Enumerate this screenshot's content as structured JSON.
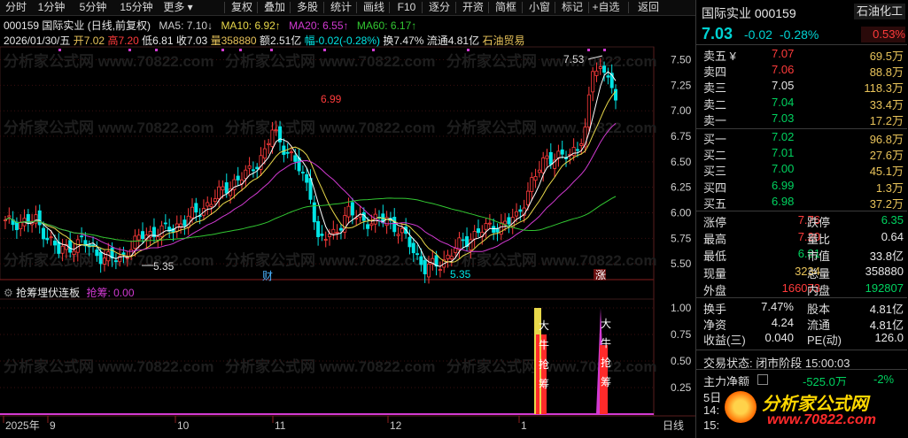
{
  "toolbar": {
    "left_items": [
      "分时",
      "1分钟",
      "5分钟",
      "15分钟",
      "更多 ▾"
    ],
    "right_items": [
      "复权",
      "叠加",
      "多股",
      "统计",
      "画线",
      "F10",
      "逐分",
      "开资",
      "简框",
      "小窗",
      "标记",
      "+自选",
      "返回"
    ]
  },
  "info_line1": {
    "code_name": "000159 国际实业 (日线,前复权)",
    "ma5": "MA5: 7.10↓",
    "ma10": "MA10: 6.92↑",
    "ma20": "MA20: 6.55↑",
    "ma60": "MA60: 6.17↑"
  },
  "info_line2": {
    "date": "2026/01/30/五",
    "open": "开7.02",
    "high": "高7.20",
    "low": "低6.81",
    "close": "收7.03",
    "volume": "量358880",
    "amount": "额2.51亿",
    "change": "幅-0.02(-0.28%)",
    "turnover": "换7.47%",
    "float_cap": "流通4.81亿",
    "sector": "石油贸易"
  },
  "watermark": "分析家公式网 www.70822.com",
  "chart": {
    "y_ticks": [
      "7.50",
      "7.25",
      "7.00",
      "6.75",
      "6.50",
      "6.25",
      "6.00",
      "5.75",
      "5.50"
    ],
    "annotations": {
      "high_label": "6.99",
      "peak_label": "7.53",
      "low_left": "5.35",
      "low_mid": "5.35"
    },
    "event_markers": {
      "cai": "财",
      "zhang": "涨"
    },
    "x_labels": [
      "2025年",
      "9",
      "10",
      "11",
      "12",
      "1"
    ],
    "period_label": "日线"
  },
  "indicator": {
    "title": "抢筹埋伏连板",
    "value_label": "抢筹: 0.00",
    "y_ticks": [
      "1.00",
      "0.75",
      "0.50",
      "0.25"
    ],
    "bar_text": "大牛抢筹"
  },
  "quote": {
    "name_code": "国际实业 000159",
    "sector": "石油化工",
    "price": "7.03",
    "change": "-0.02",
    "change_pct": "-0.28%",
    "sector_pct": "0.53%",
    "asks": [
      {
        "label": "卖五 ¥",
        "price": "7.07",
        "vol": "69.5万"
      },
      {
        "label": "卖四",
        "price": "7.06",
        "vol": "88.8万"
      },
      {
        "label": "卖三",
        "price": "7.05",
        "vol": "118.3万"
      },
      {
        "label": "卖二",
        "price": "7.04",
        "vol": "33.4万"
      },
      {
        "label": "卖一",
        "price": "7.03",
        "vol": "17.2万"
      }
    ],
    "bids": [
      {
        "label": "买一",
        "price": "7.02",
        "vol": "96.8万"
      },
      {
        "label": "买二",
        "price": "7.01",
        "vol": "27.6万"
      },
      {
        "label": "买三",
        "price": "7.00",
        "vol": "45.1万"
      },
      {
        "label": "买四",
        "price": "6.99",
        "vol": "1.3万"
      },
      {
        "label": "买五",
        "price": "6.98",
        "vol": "37.2万"
      }
    ],
    "stats": [
      {
        "l1": "涨停",
        "v1": "7.76",
        "l2": "跌停",
        "v2": "6.35"
      },
      {
        "l1": "最高",
        "v1": "7.20",
        "l2": "量比",
        "v2": "0.64"
      },
      {
        "l1": "最低",
        "v1": "6.81",
        "l2": "市值",
        "v2": "33.8亿"
      },
      {
        "l1": "现量",
        "v1": "3234",
        "l2": "总量",
        "v2": "358880"
      },
      {
        "l1": "外盘",
        "v1": "166073",
        "l2": "内盘",
        "v2": "192807"
      }
    ],
    "stats2": [
      {
        "l1": "换手",
        "v1": "7.47%",
        "l2": "股本",
        "v2": "4.81亿"
      },
      {
        "l1": "净资",
        "v1": "4.24",
        "l2": "流通",
        "v2": "4.81亿"
      },
      {
        "l1": "收益(三)",
        "v1": "0.040",
        "l2": "PE(动)",
        "v2": "126.0"
      }
    ],
    "trade_status": "交易状态: 闭市阶段 15:00:03",
    "main_net_label": "主力净额",
    "main_net_value": "-525.0万",
    "main_net_pct": "-2%",
    "partial_rows": [
      "5日",
      "14:",
      "15:"
    ],
    "brand": "分析家公式网",
    "brand_url": "www.70822.com"
  },
  "colors": {
    "up": "#ff3b3b",
    "down": "#00e5e5",
    "ma5": "#ffffff",
    "ma10": "#e8d84a",
    "ma20": "#d23ad2",
    "ma60": "#32c832"
  }
}
